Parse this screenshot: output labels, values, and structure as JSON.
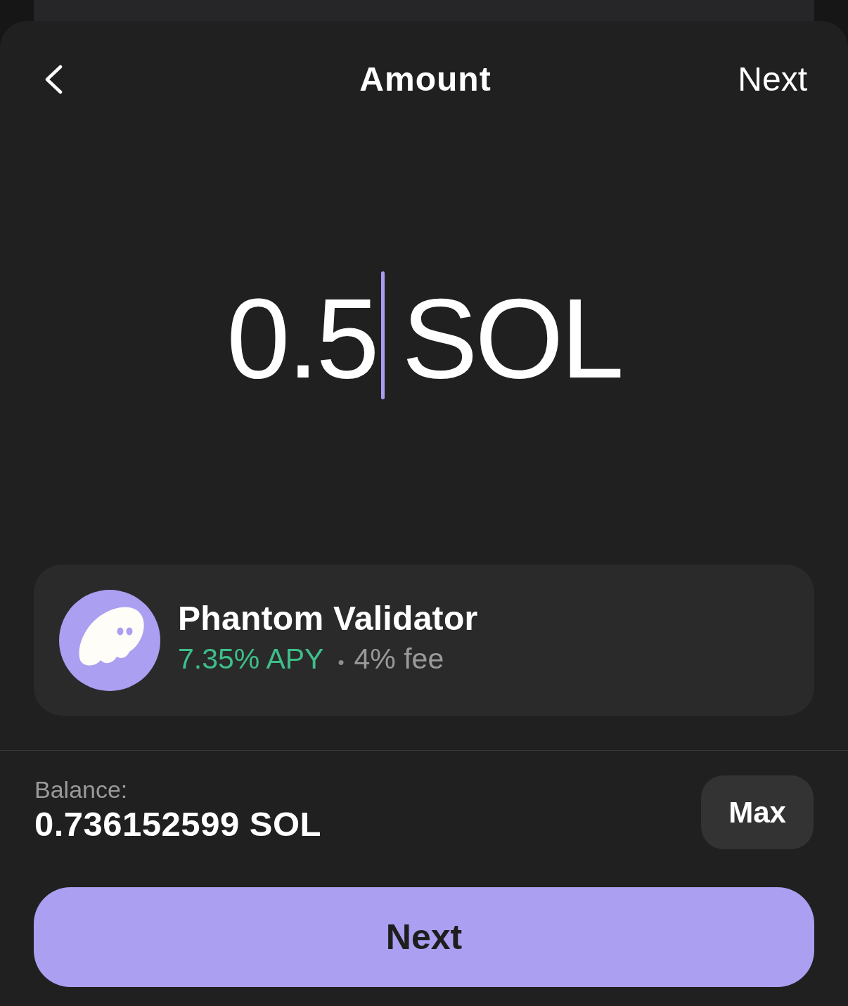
{
  "header": {
    "title": "Amount",
    "action": "Next"
  },
  "amount": {
    "value": "0.5",
    "unit": "SOL",
    "focused": true
  },
  "validator": {
    "name": "Phantom Validator",
    "apy": "7.35% APY",
    "separator": "•",
    "fee": "4% fee"
  },
  "balance": {
    "label": "Balance:",
    "value": "0.736152599 SOL",
    "max_button": "Max"
  },
  "primary_button": "Next"
}
